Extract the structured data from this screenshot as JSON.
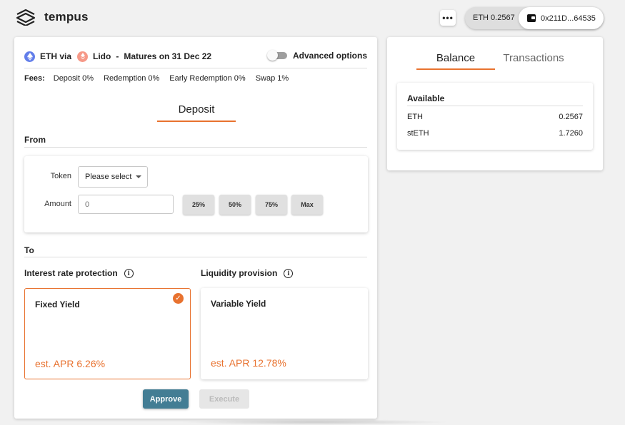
{
  "header": {
    "app_name": "tempus",
    "more_label": "•••",
    "wallet_balance": "ETH 0.2567",
    "wallet_address": "0x211D...64535"
  },
  "pool": {
    "asset": "ETH via",
    "protocol": "Lido",
    "separator": "-",
    "maturity": "Matures on 31 Dec 22",
    "advanced_label": "Advanced options",
    "advanced_enabled": false
  },
  "fees": {
    "label": "Fees:",
    "items": [
      "Deposit 0%",
      "Redemption 0%",
      "Early Redemption 0%",
      "Swap 1%"
    ]
  },
  "deposit": {
    "tab_label": "Deposit",
    "from_label": "From",
    "token_label": "Token",
    "token_select": "Please select",
    "amount_label": "Amount",
    "amount_placeholder": "0",
    "percent_buttons": [
      "25%",
      "50%",
      "75%",
      "Max"
    ],
    "to_label": "To",
    "interest_label": "Interest rate protection",
    "liquidity_label": "Liquidity provision",
    "fixed": {
      "title": "Fixed Yield",
      "apr": "est. APR 6.26%",
      "selected": true
    },
    "variable": {
      "title": "Variable Yield",
      "apr": "est. APR 12.78%",
      "selected": false
    },
    "approve_label": "Approve",
    "execute_label": "Execute"
  },
  "side": {
    "tabs": [
      "Balance",
      "Transactions"
    ],
    "active_tab": "Balance",
    "available_label": "Available",
    "balances": [
      {
        "token": "ETH",
        "amount": "0.2567"
      },
      {
        "token": "stETH",
        "amount": "1.7260"
      }
    ]
  },
  "colors": {
    "accent": "#e8722f",
    "primary_button": "#437d94",
    "eth": "#627eea",
    "lido": "#f69988"
  }
}
